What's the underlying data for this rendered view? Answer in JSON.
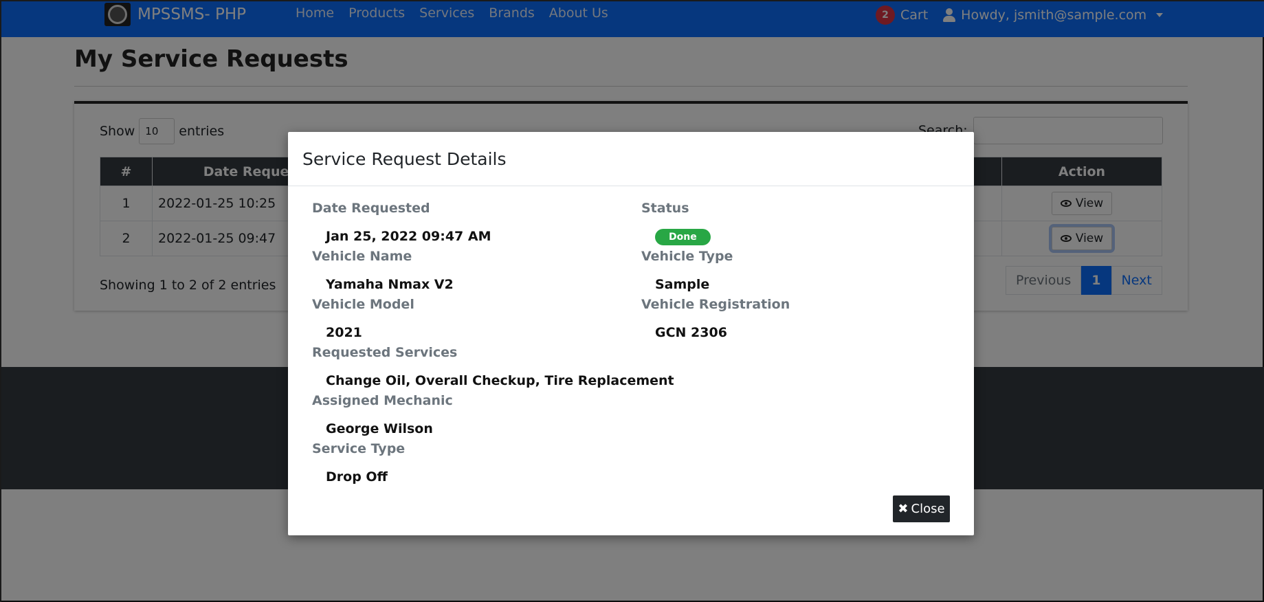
{
  "navbar": {
    "brand": "MPSSMS- PHP",
    "links": [
      "Home",
      "Products",
      "Services",
      "Brands",
      "About Us"
    ],
    "cart_count": "2",
    "cart_label": "Cart",
    "user_label": "Howdy, jsmith@sample.com"
  },
  "page": {
    "title": "My Service Requests",
    "show_label": "Show",
    "entries_value": "10",
    "entries_label": "entries",
    "search_label": "Search:",
    "table": {
      "headers": [
        "#",
        "Date Requested",
        "Action"
      ],
      "rows": [
        {
          "num": "1",
          "date": "2022-01-25 10:25",
          "action": "View"
        },
        {
          "num": "2",
          "date": "2022-01-25 09:47",
          "action": "View"
        }
      ]
    },
    "showing_text": "Showing 1 to 2 of 2 entries",
    "pagination": {
      "previous": "Previous",
      "current": "1",
      "next": "Next"
    }
  },
  "modal": {
    "title": "Service Request Details",
    "fields": {
      "date_requested_label": "Date Requested",
      "date_requested_value": "Jan 25, 2022 09:47 AM",
      "status_label": "Status",
      "status_value": "Done",
      "vehicle_name_label": "Vehicle Name",
      "vehicle_name_value": "Yamaha Nmax V2",
      "vehicle_type_label": "Vehicle Type",
      "vehicle_type_value": "Sample",
      "vehicle_model_label": "Vehicle Model",
      "vehicle_model_value": "2021",
      "vehicle_registration_label": "Vehicle Registration",
      "vehicle_registration_value": "GCN 2306",
      "requested_services_label": "Requested Services",
      "requested_services_value": "Change Oil, Overall Checkup, Tire Replacement",
      "assigned_mechanic_label": "Assigned Mechanic",
      "assigned_mechanic_value": "George Wilson",
      "service_type_label": "Service Type",
      "service_type_value": "Drop Off"
    },
    "close_label": "Close"
  },
  "colors": {
    "navbar": "#0d6efd",
    "status_done": "#28a745",
    "table_header": "#343a40"
  }
}
